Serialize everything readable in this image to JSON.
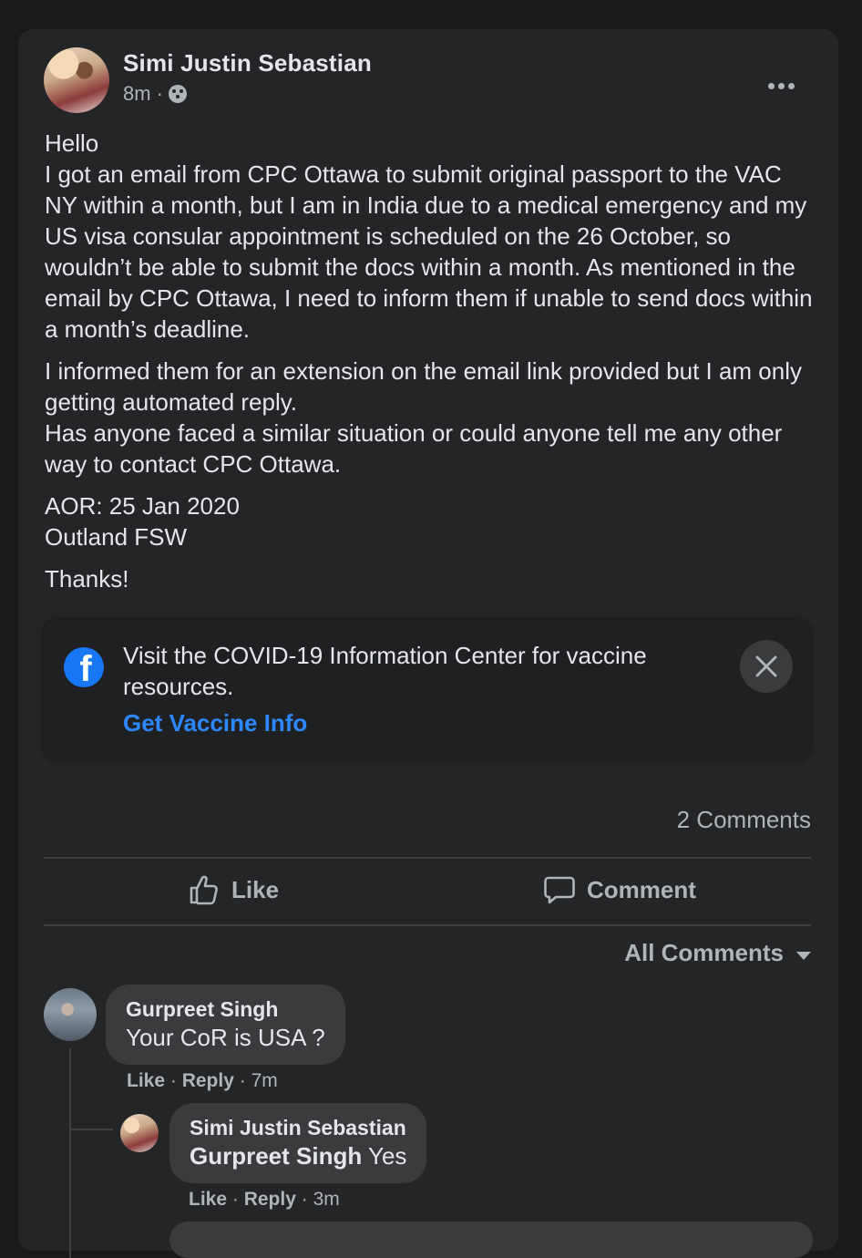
{
  "post": {
    "author": "Simi Justin Sebastian",
    "time": "8m",
    "dot": "·",
    "paragraphs": [
      "Hello\nI got an email from CPC Ottawa to submit original passport to the VAC NY within a month, but I am in India due to a medical emergency and my US visa consular appointment is scheduled on the 26 October, so wouldn’t be able to submit the docs within a month. As mentioned in the email by CPC Ottawa, I need to inform them if unable to send docs within a month’s deadline.",
      "I informed them for an extension on the email link provided but I am only getting automated reply.\nHas anyone faced a similar situation or could anyone tell me  any other way to contact CPC Ottawa.",
      "AOR: 25 Jan 2020\nOutland FSW",
      "Thanks!"
    ]
  },
  "covid_banner": {
    "text": "Visit the COVID-19 Information Center for vaccine resources.",
    "link": "Get Vaccine Info",
    "brand_color": "#1877f2",
    "link_color": "#2d88ff"
  },
  "stats": {
    "comments_count": "2 Comments"
  },
  "actions": {
    "like": "Like",
    "comment": "Comment"
  },
  "comments_filter": "All Comments",
  "comments": [
    {
      "author": "Gurpreet Singh",
      "text": "Your CoR is USA ?",
      "like": "Like",
      "reply": "Reply",
      "time": "7m"
    }
  ],
  "reply": {
    "author": "Simi Justin Sebastian",
    "mention": "Gurpreet Singh",
    "text": " Yes",
    "like": "Like",
    "reply": "Reply",
    "time": "3m"
  }
}
